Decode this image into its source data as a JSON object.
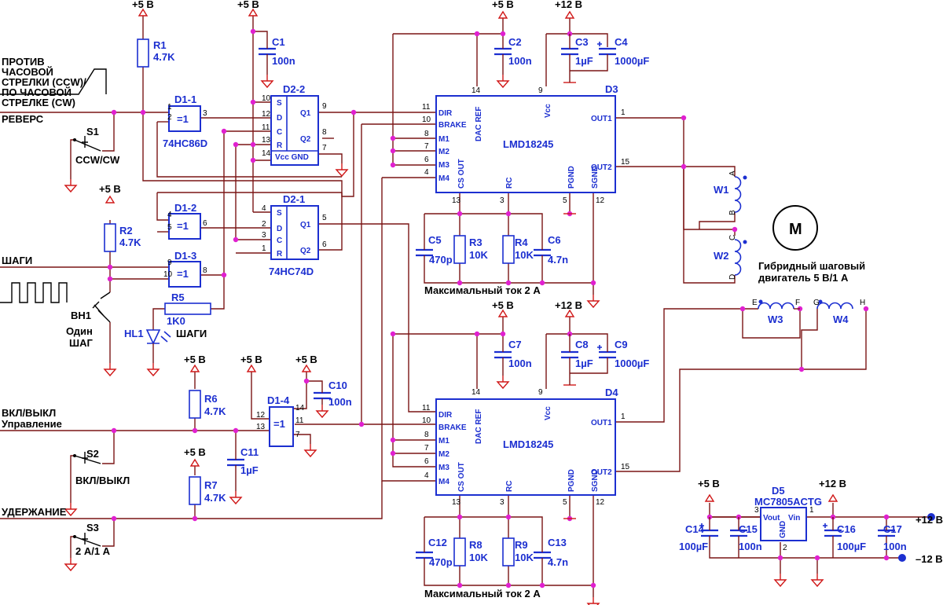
{
  "rails": {
    "p5": "+5 В",
    "p12": "+12 В",
    "m12": "–12 В"
  },
  "inputs": {
    "direction_caption": [
      "ПРОТИВ",
      "ЧАСОВОЙ",
      "СТРЕЛКИ (CCW)/",
      "ПО ЧАСОВОЙ",
      "СТРЕЛКЕ (CW)"
    ],
    "reverse": "РЕВЕРС",
    "steps": "ШАГИ",
    "enable": "ВКЛ/ВЫКЛ",
    "enable_sub": "Управление",
    "hold": "УДЕРЖАНИЕ",
    "bh1_name": "ВН1",
    "bh1_caption": [
      "Один",
      "ШАГ"
    ],
    "hl1_name": "HL1",
    "hl1_caption": "ШАГИ"
  },
  "switches": {
    "s1": {
      "name": "S1",
      "label": "CCW/CW"
    },
    "s2": {
      "name": "S2",
      "label": "ВКЛ/ВЫКЛ"
    },
    "s3": {
      "name": "S3",
      "label": "2 А/1 А"
    }
  },
  "resistors": {
    "r1": {
      "name": "R1",
      "value": "4.7K"
    },
    "r2": {
      "name": "R2",
      "value": "4.7K"
    },
    "r3": {
      "name": "R3",
      "value": "10K"
    },
    "r4": {
      "name": "R4",
      "value": "10K"
    },
    "r5": {
      "name": "R5",
      "value": "1K0"
    },
    "r6": {
      "name": "R6",
      "value": "4.7K"
    },
    "r7": {
      "name": "R7",
      "value": "4.7K"
    },
    "r8": {
      "name": "R8",
      "value": "10K"
    },
    "r9": {
      "name": "R9",
      "value": "10K"
    }
  },
  "capacitors": {
    "c1": {
      "name": "C1",
      "value": "100n"
    },
    "c2": {
      "name": "C2",
      "value": "100n"
    },
    "c3": {
      "name": "C3",
      "value": "1µF"
    },
    "c4": {
      "name": "C4",
      "value": "1000µF"
    },
    "c5": {
      "name": "C5",
      "value": "470p"
    },
    "c6": {
      "name": "C6",
      "value": "4.7n"
    },
    "c7": {
      "name": "C7",
      "value": "100n"
    },
    "c8": {
      "name": "C8",
      "value": "1µF"
    },
    "c9": {
      "name": "C9",
      "value": "1000µF"
    },
    "c10": {
      "name": "C10",
      "value": "100n"
    },
    "c11": {
      "name": "C11",
      "value": "1µF"
    },
    "c12": {
      "name": "C12",
      "value": "470p"
    },
    "c13": {
      "name": "C13",
      "value": "4.7n"
    },
    "c14": {
      "name": "C14",
      "value": "100µF"
    },
    "c15": {
      "name": "C15",
      "value": "100n"
    },
    "c16": {
      "name": "C16",
      "value": "100µF"
    },
    "c17": {
      "name": "C17",
      "value": "100n"
    }
  },
  "logic": {
    "d1_1": "D1-1",
    "d1_2": "D1-2",
    "d1_3": "D1-3",
    "d1_4": "D1-4",
    "xor_sym": "=1",
    "d1_part": "74HC86D",
    "d2_1": "D2-1",
    "d2_2": "D2-2",
    "d2_part": "74HC74D",
    "ff_pins": [
      "S",
      "D",
      "C",
      "R",
      "Q1",
      "Q2"
    ],
    "vcc_gnd": "Vcc GND"
  },
  "drivers": {
    "d3": "D3",
    "d4": "D4",
    "part": "LMD18245",
    "inputs": [
      "DIR",
      "BRAKE",
      "M1",
      "M2",
      "M3",
      "M4"
    ],
    "outputs": [
      "OUT1",
      "OUT2"
    ],
    "bottom": [
      "CS OUT",
      "RC",
      "PGND",
      "SGND"
    ],
    "top": [
      "DAC REF",
      "Vcc"
    ],
    "max_current": "Максимальный ток 2 А"
  },
  "motor": {
    "symbol": "M",
    "caption": [
      "Гибридный шаговый",
      "двигатель 5 В/1 А"
    ],
    "w1": "W1",
    "w2": "W2",
    "w3": "W3",
    "w4": "W4",
    "taps": [
      "A",
      "B",
      "C",
      "D",
      "E",
      "F",
      "G",
      "H"
    ]
  },
  "regulator": {
    "name": "D5",
    "part": "MC7805ACTG",
    "vout": "Vout",
    "vin": "Vin",
    "gnd": "GND"
  }
}
